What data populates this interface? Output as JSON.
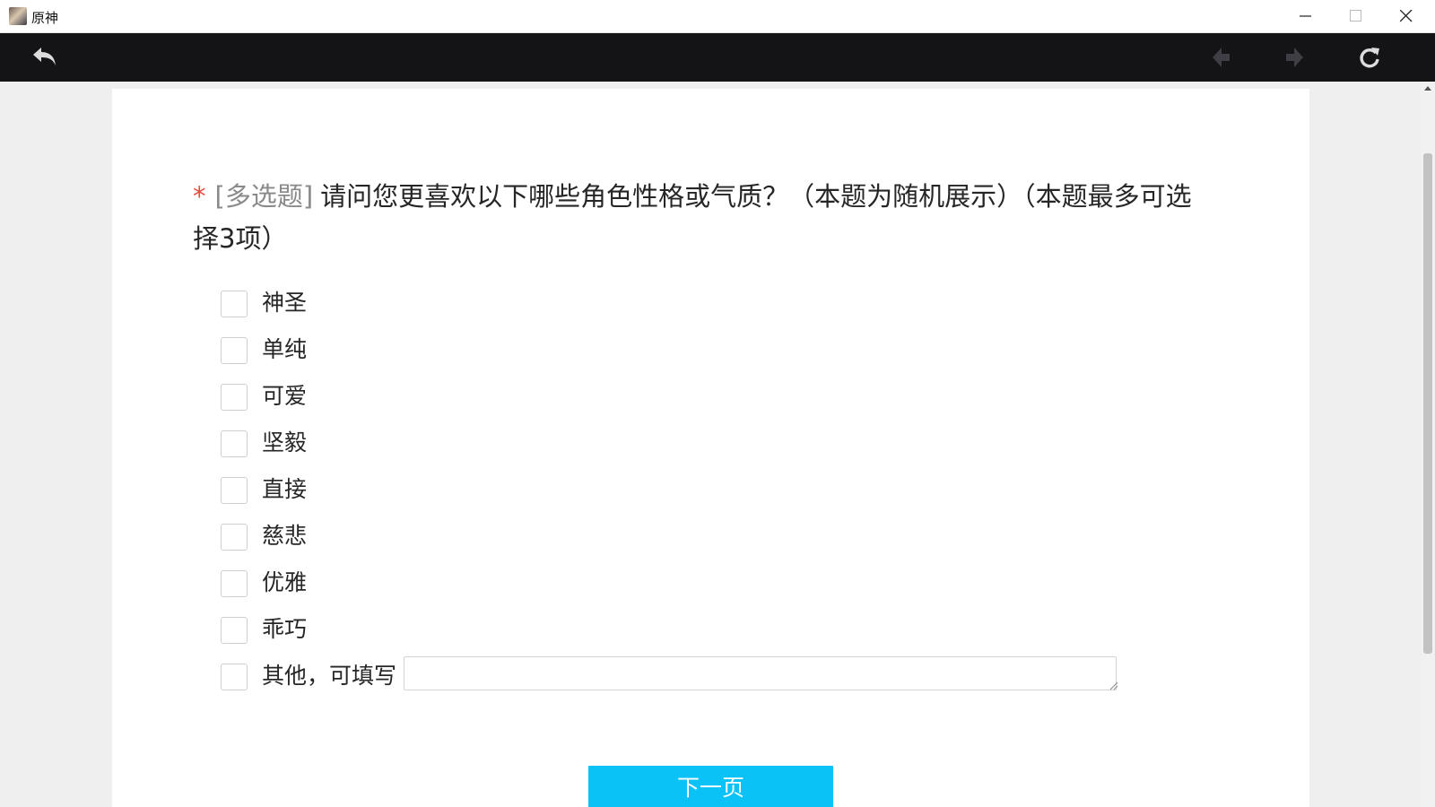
{
  "window": {
    "title": "原神",
    "controls": [
      "minimize",
      "maximize",
      "close"
    ]
  },
  "toolbar": {
    "icons": [
      "back-arrow-icon",
      "prev-arrow-icon",
      "next-arrow-icon",
      "refresh-icon"
    ]
  },
  "question": {
    "required_mark": "*",
    "type_tag": "[多选题]",
    "text": "请问您更喜欢以下哪些角色性格或气质？（本题为随机展示）（本题最多可选择3项）"
  },
  "options": [
    {
      "label": "神圣",
      "checked": false
    },
    {
      "label": "单纯",
      "checked": false
    },
    {
      "label": "可爱",
      "checked": false
    },
    {
      "label": "坚毅",
      "checked": false
    },
    {
      "label": "直接",
      "checked": false
    },
    {
      "label": "慈悲",
      "checked": false
    },
    {
      "label": "优雅",
      "checked": false
    },
    {
      "label": "乖巧",
      "checked": false
    },
    {
      "label": "其他，可填写",
      "checked": false,
      "other_value": ""
    }
  ],
  "next_button": {
    "label": "下一页"
  },
  "colors": {
    "accent": "#0ac2f5",
    "toolbar_bg": "#141416",
    "required": "#e84b3c",
    "page_bg": "#efefef"
  }
}
